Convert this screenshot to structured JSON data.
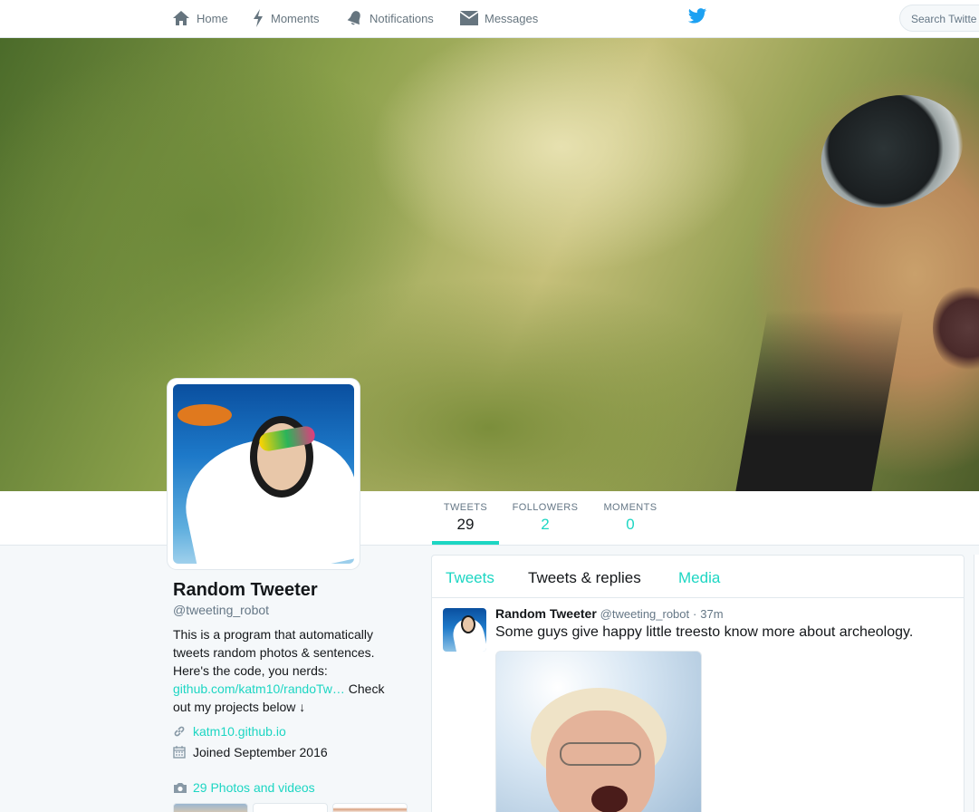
{
  "nav": {
    "home": "Home",
    "moments": "Moments",
    "notifications": "Notifications",
    "messages": "Messages",
    "search_placeholder": "Search Twitter",
    "search_visible": "Search Twitte",
    "icons": [
      "home-icon",
      "lightning-icon",
      "bell-icon",
      "envelope-icon",
      "twitter-bird-icon"
    ]
  },
  "stats": {
    "tweets_label": "TWEETS",
    "tweets_value": "29",
    "followers_label": "FOLLOWERS",
    "followers_value": "2",
    "moments_label": "MOMENTS",
    "moments_value": "0"
  },
  "profile": {
    "name": "Random Tweeter",
    "handle": "@tweeting_robot",
    "bio_part1": "This is a program that automatically tweets random photos & sentences. Here's the code, you nerds: ",
    "bio_link": "github.com/katm10/randoTw…",
    "bio_part2": " Check out my projects below ↓",
    "url": "katm10.github.io",
    "joined": "Joined September 2016",
    "photos": "29 Photos and videos"
  },
  "timeline": {
    "tabs": [
      "Tweets",
      "Tweets & replies",
      "Media"
    ],
    "tweet": {
      "name": "Random Tweeter",
      "handle": "@tweeting_robot",
      "dot": "·",
      "time": "37m",
      "text": "Some guys give happy little treesto know more about archeology."
    }
  },
  "colors": {
    "accent": "#1dd6c3",
    "text": "#14171a",
    "muted": "#657786",
    "background": "#f5f8fa"
  }
}
